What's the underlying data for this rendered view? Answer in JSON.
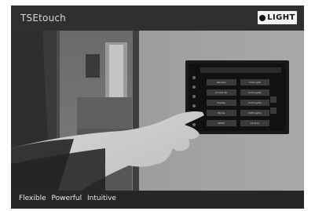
{
  "header": {
    "brand": "TSEtouch",
    "logo_text": "LIGHT"
  },
  "photo": {
    "alt": "hand touching wall-mounted touchscreen control panel",
    "panel": {
      "buttons": [
        {
          "label": "Paradisi"
        },
        {
          "label": "Cold Light"
        },
        {
          "label": "Accent Ter"
        },
        {
          "label": "Cold Lights"
        },
        {
          "label": "Display"
        },
        {
          "label": "Cold Lights"
        },
        {
          "label": "Blinds"
        },
        {
          "label": "Shift Lights"
        },
        {
          "label": "MHPS"
        },
        {
          "label": "Alt Dim"
        }
      ]
    }
  },
  "footer": {
    "taglines": [
      "Flexible",
      "Powerful",
      "Intuitive"
    ]
  },
  "colors": {
    "frame": "#2b2b2b",
    "header": "#2f2f2f",
    "footer": "#262626",
    "logo_bg": "#f2f2f2"
  }
}
